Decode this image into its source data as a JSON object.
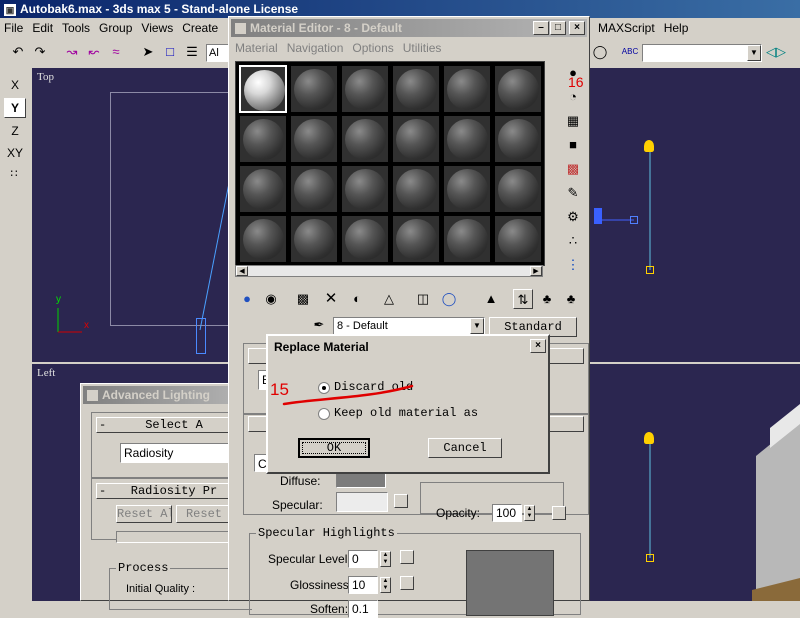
{
  "main_window": {
    "title": "Autobak6.max - 3ds max 5 - Stand-alone License",
    "menu": [
      "File",
      "Edit",
      "Tools",
      "Group",
      "Views",
      "Create"
    ],
    "menu_right": [
      "MAXScript",
      "Help"
    ],
    "toolbar_text": "Al"
  },
  "axis_buttons": [
    "X",
    "Y",
    "Z",
    "XY"
  ],
  "viewports": {
    "top": "Top",
    "left": "Left"
  },
  "viewport_axes": {
    "y": "y",
    "x": "x"
  },
  "material_editor": {
    "title": "Material Editor - 8 - Default",
    "menu": [
      "Material",
      "Navigation",
      "Options",
      "Utilities"
    ],
    "material_name": "8 - Default",
    "type_button": "Standard",
    "shader_value": "B",
    "side_value": "C",
    "diffuse_label": "Diffuse:",
    "specular_label": "Specular:",
    "opacity_label": "Opacity:",
    "opacity_value": "100",
    "specular_highlights_title": "Specular Highlights",
    "specular_level_label": "Specular Level:",
    "specular_level_value": "0",
    "glossiness_label": "Glossiness:",
    "glossiness_value": "10",
    "soften_label": "Soften:",
    "soften_value": "0.1"
  },
  "annotations": {
    "num15": "15",
    "num16": "16"
  },
  "advanced_lighting": {
    "title": "Advanced Lighting",
    "select_title": "Select A",
    "dropdown": "Radiosity",
    "radiosity_title": "Radiosity Pr",
    "reset_all": "Reset All",
    "reset": "Reset",
    "process_label": "Process",
    "initial_quality": "Initial Quality :"
  },
  "dialog": {
    "title": "Replace Material",
    "option1": "Discard old",
    "option2": "Keep old material as",
    "ok": "OK",
    "cancel": "Cancel",
    "selected": "discard"
  },
  "colors": {
    "accent": "#0a246a",
    "viewport": "#2b2650",
    "annotation": "#e00000"
  }
}
